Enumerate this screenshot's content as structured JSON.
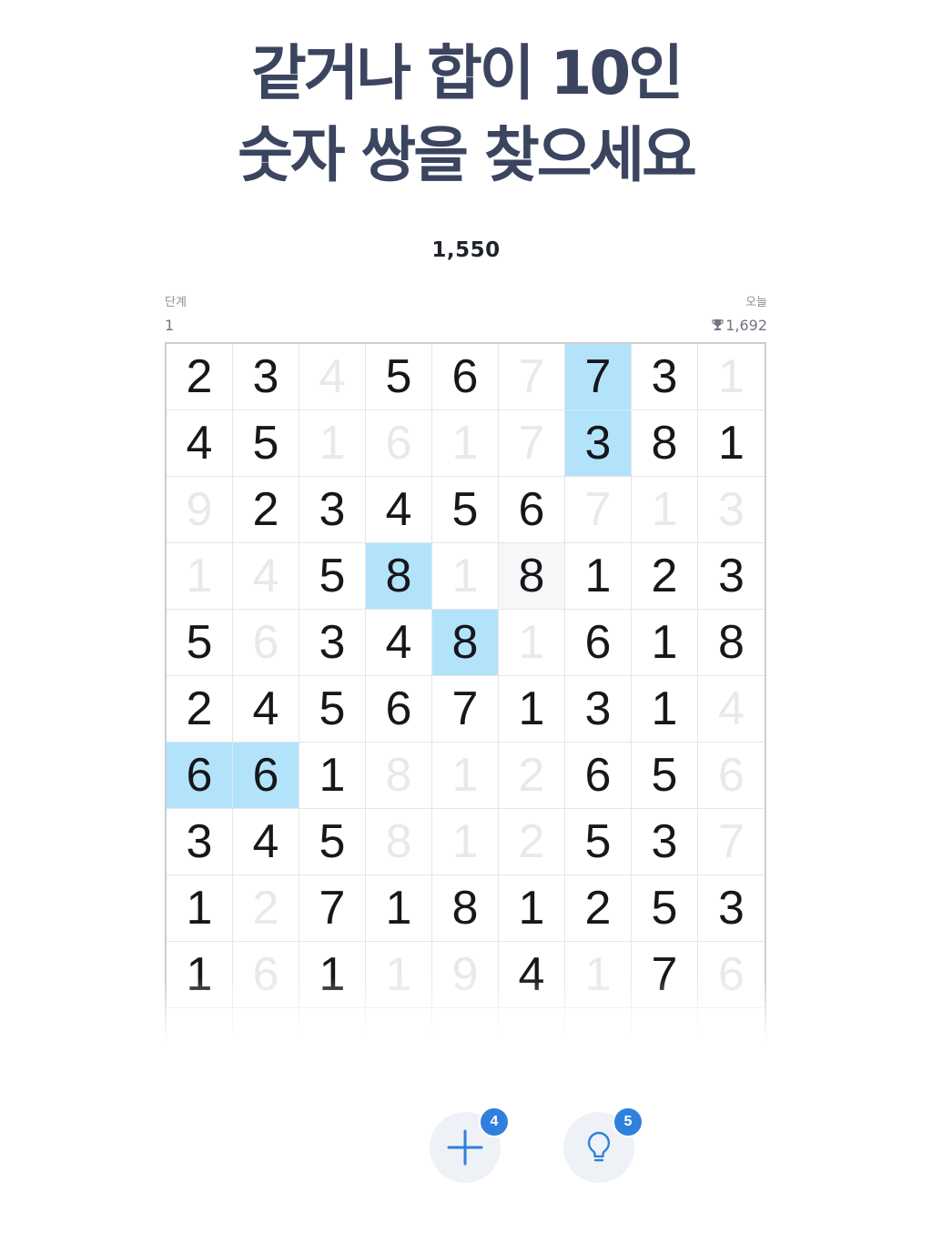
{
  "headline": {
    "line1": "같거나 합이 10인",
    "line2": "숫자 쌍을 찾으세요"
  },
  "score": "1,550",
  "level": {
    "label": "단계",
    "value": "1"
  },
  "today": {
    "label": "오늘",
    "value": "1,692",
    "icon": "trophy-icon"
  },
  "board": {
    "columns": 9,
    "rows": [
      [
        {
          "v": "2"
        },
        {
          "v": "3"
        },
        {
          "v": "4",
          "dim": true
        },
        {
          "v": "5"
        },
        {
          "v": "6"
        },
        {
          "v": "7",
          "dim": true
        },
        {
          "v": "7",
          "sel": true
        },
        {
          "v": "3"
        },
        {
          "v": "1",
          "dim": true
        }
      ],
      [
        {
          "v": "4"
        },
        {
          "v": "5"
        },
        {
          "v": "1",
          "dim": true
        },
        {
          "v": "6",
          "dim": true
        },
        {
          "v": "1",
          "dim": true
        },
        {
          "v": "7",
          "dim": true
        },
        {
          "v": "3",
          "sel": true
        },
        {
          "v": "8"
        },
        {
          "v": "1"
        }
      ],
      [
        {
          "v": "9",
          "dim": true
        },
        {
          "v": "2"
        },
        {
          "v": "3"
        },
        {
          "v": "4"
        },
        {
          "v": "5"
        },
        {
          "v": "6"
        },
        {
          "v": "7",
          "dim": true
        },
        {
          "v": "1",
          "dim": true
        },
        {
          "v": "3",
          "dim": true
        }
      ],
      [
        {
          "v": "1",
          "dim": true
        },
        {
          "v": "4",
          "dim": true
        },
        {
          "v": "5"
        },
        {
          "v": "8",
          "sel": true
        },
        {
          "v": "1",
          "dim": true
        },
        {
          "v": "8",
          "hint": true
        },
        {
          "v": "1"
        },
        {
          "v": "2"
        },
        {
          "v": "3"
        }
      ],
      [
        {
          "v": "5"
        },
        {
          "v": "6",
          "dim": true
        },
        {
          "v": "3"
        },
        {
          "v": "4"
        },
        {
          "v": "8",
          "sel": true
        },
        {
          "v": "1",
          "dim": true
        },
        {
          "v": "6"
        },
        {
          "v": "1"
        },
        {
          "v": "8"
        }
      ],
      [
        {
          "v": "2"
        },
        {
          "v": "4"
        },
        {
          "v": "5"
        },
        {
          "v": "6"
        },
        {
          "v": "7"
        },
        {
          "v": "1"
        },
        {
          "v": "3"
        },
        {
          "v": "1"
        },
        {
          "v": "4",
          "dim": true
        }
      ],
      [
        {
          "v": "6",
          "sel": true
        },
        {
          "v": "6",
          "sel": true
        },
        {
          "v": "1"
        },
        {
          "v": "8",
          "dim": true
        },
        {
          "v": "1",
          "dim": true
        },
        {
          "v": "2",
          "dim": true
        },
        {
          "v": "6"
        },
        {
          "v": "5"
        },
        {
          "v": "6",
          "dim": true
        }
      ],
      [
        {
          "v": "3"
        },
        {
          "v": "4"
        },
        {
          "v": "5"
        },
        {
          "v": "8",
          "dim": true
        },
        {
          "v": "1",
          "dim": true
        },
        {
          "v": "2",
          "dim": true
        },
        {
          "v": "5"
        },
        {
          "v": "3"
        },
        {
          "v": "7",
          "dim": true
        }
      ],
      [
        {
          "v": "1"
        },
        {
          "v": "2",
          "dim": true
        },
        {
          "v": "7"
        },
        {
          "v": "1"
        },
        {
          "v": "8"
        },
        {
          "v": "1"
        },
        {
          "v": "2"
        },
        {
          "v": "5"
        },
        {
          "v": "3"
        }
      ],
      [
        {
          "v": "1"
        },
        {
          "v": "6",
          "dim": true
        },
        {
          "v": "1"
        },
        {
          "v": "1",
          "dim": true
        },
        {
          "v": "9",
          "dim": true
        },
        {
          "v": "4"
        },
        {
          "v": "1",
          "dim": true
        },
        {
          "v": "7"
        },
        {
          "v": "6",
          "dim": true
        }
      ],
      [
        {
          "v": ""
        },
        {
          "v": ""
        },
        {
          "v": ""
        },
        {
          "v": ""
        },
        {
          "v": ""
        },
        {
          "v": ""
        },
        {
          "v": ""
        },
        {
          "v": ""
        },
        {
          "v": ""
        }
      ]
    ]
  },
  "actions": {
    "add": {
      "icon": "plus-icon",
      "badge": "4"
    },
    "hint": {
      "icon": "lightbulb-icon",
      "badge": "5"
    }
  },
  "colors": {
    "headline": "#3b4560",
    "selected_cell": "#b3e3fb",
    "badge": "#2f80dd",
    "icon": "#2f80dd",
    "button_bg": "#eef2f6"
  }
}
